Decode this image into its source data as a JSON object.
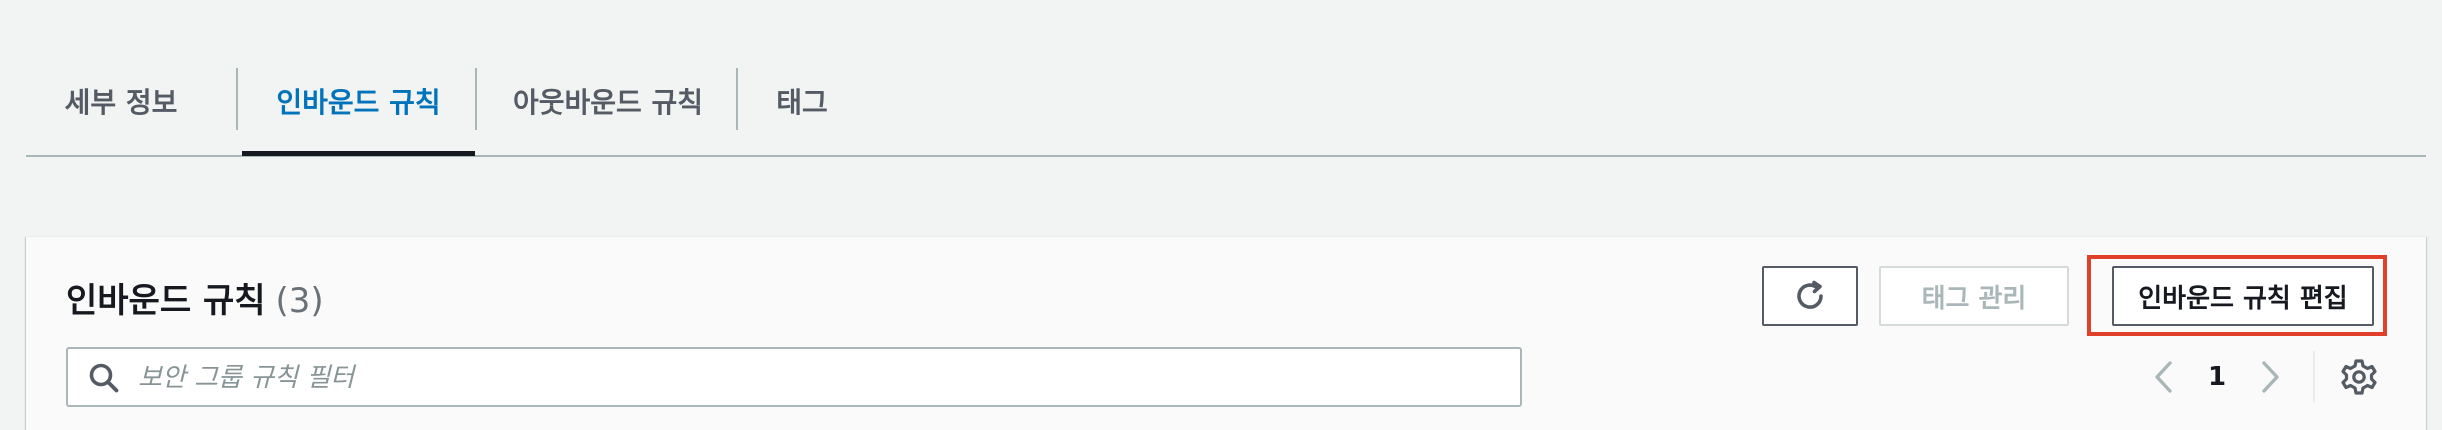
{
  "tabs": [
    {
      "label": "세부 정보",
      "active": false
    },
    {
      "label": "인바운드 규칙",
      "active": true
    },
    {
      "label": "아웃바운드 규칙",
      "active": false
    },
    {
      "label": "태그",
      "active": false
    }
  ],
  "panel": {
    "title": "인바운드 규칙",
    "count": "(3)",
    "buttons": {
      "refresh_icon": "refresh-icon",
      "manage_tags": "태그 관리",
      "edit_rules": "인바운드 규칙 편집"
    },
    "search": {
      "placeholder": "보안 그룹 규칙 필터",
      "value": ""
    },
    "pagination": {
      "current_page": "1"
    }
  },
  "colors": {
    "background": "#f2f3f3",
    "active_tab": "#0073bb",
    "highlight_border": "#e0402a",
    "text_primary": "#16191f",
    "text_secondary": "#545b64",
    "disabled": "#aab7b8"
  },
  "icons": [
    "refresh-icon",
    "search-icon",
    "chevron-left-icon",
    "chevron-right-icon",
    "gear-icon"
  ]
}
